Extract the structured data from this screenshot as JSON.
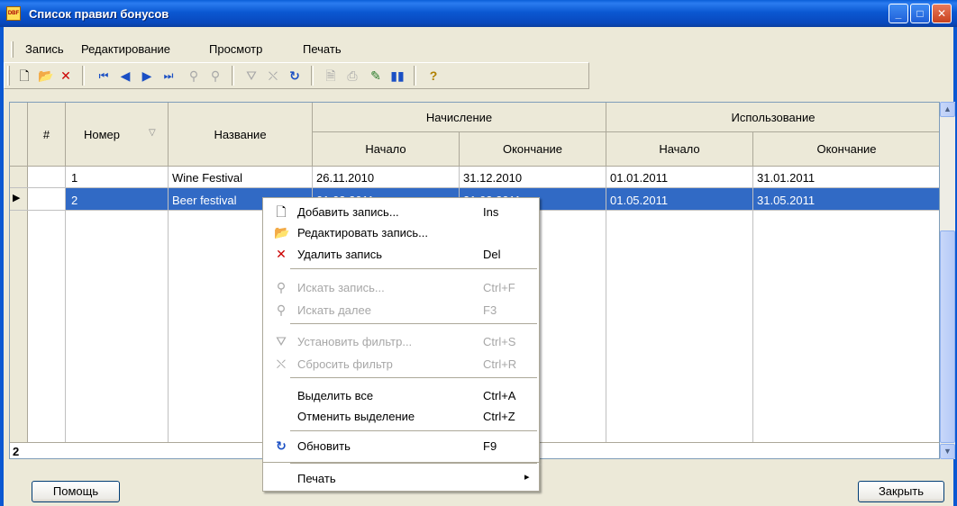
{
  "window": {
    "title": "Список правил бонусов",
    "icon": "app-icon",
    "controls": {
      "minimize": "_",
      "maximize": "□",
      "close": "✕"
    }
  },
  "menu": [
    "Запись",
    "Редактирование",
    "Просмотр",
    "Печать"
  ],
  "toolbar": {
    "icons": [
      "new-record-icon",
      "edit-folder-icon",
      "delete-icon",
      "first-record-icon",
      "prev-record-icon",
      "next-record-icon",
      "last-record-icon",
      "find-icon",
      "find-next-icon",
      "filter-icon",
      "clear-filter-icon",
      "refresh-icon",
      "preview-icon",
      "print-icon",
      "report-icon",
      "chart-icon",
      "help-icon"
    ]
  },
  "grid": {
    "headers": {
      "num": "#",
      "number": "Номер",
      "name": "Название",
      "accrual": "Начисление",
      "usage": "Использование",
      "start": "Начало",
      "end": "Окончание",
      "sort_indicator": "▽"
    },
    "rows": [
      {
        "number": "1",
        "name": "Wine Festival",
        "acc_start": "26.11.2010",
        "acc_end": "31.12.2010",
        "use_start": "01.01.2011",
        "use_end": "31.01.2011"
      },
      {
        "number": "2",
        "name": "Beer festival",
        "acc_start": "01.03.2011",
        "acc_end": "31.03.2011",
        "use_start": "01.05.2011",
        "use_end": "31.05.2011"
      }
    ],
    "footer_count": "2",
    "row_indicator": "▶"
  },
  "context_menu": [
    {
      "label": "Добавить запись...",
      "key": "Ins",
      "icon": "new-record-icon",
      "enabled": true
    },
    {
      "label": "Редактировать запись...",
      "key": "",
      "icon": "edit-folder-icon",
      "enabled": true
    },
    {
      "label": "Удалить запись",
      "key": "Del",
      "icon": "delete-icon",
      "enabled": true
    },
    {
      "label": "Искать запись...",
      "key": "Ctrl+F",
      "icon": "find-icon",
      "enabled": false
    },
    {
      "label": "Искать далее",
      "key": "F3",
      "icon": "find-next-icon",
      "enabled": false
    },
    {
      "label": "Установить фильтр...",
      "key": "Ctrl+S",
      "icon": "filter-icon",
      "enabled": false
    },
    {
      "label": "Сбросить фильтр",
      "key": "Ctrl+R",
      "icon": "clear-filter-icon",
      "enabled": false
    },
    {
      "label": "Выделить все",
      "key": "Ctrl+A",
      "icon": "",
      "enabled": true
    },
    {
      "label": "Отменить выделение",
      "key": "Ctrl+Z",
      "icon": "",
      "enabled": true
    },
    {
      "label": "Обновить",
      "key": "F9",
      "icon": "refresh-icon",
      "enabled": true
    },
    {
      "label": "Печать",
      "key": "▸",
      "icon": "",
      "enabled": true
    }
  ],
  "buttons": {
    "help": "Помощь",
    "close": "Закрыть"
  },
  "colors": {
    "selection": "#316ac5",
    "titlebar": "#0b58d2",
    "delete_red": "#cc0000",
    "refresh_blue": "#1a4fc4"
  }
}
